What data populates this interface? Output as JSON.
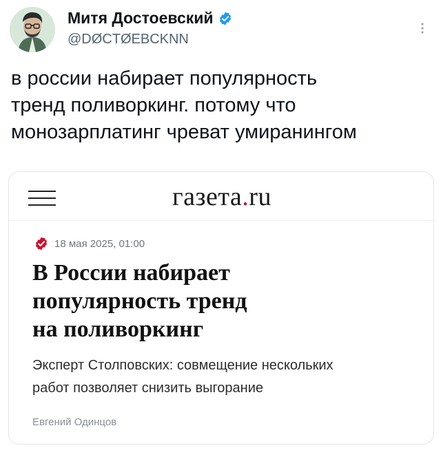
{
  "tweet": {
    "display_name": "Митя Достоевский",
    "handle": "@DØCTØEBCKNN",
    "verified": true,
    "text": "в россии набирает популярность\nтренд поливоркинг. потому что\nмонозарплатинг чреват умиранингом",
    "icons": {
      "avatar": "avatar-portrait",
      "verified": "verified-badge-icon",
      "more": "more-vertical-icon"
    }
  },
  "card": {
    "logo": {
      "main": "газета",
      "dot": ".",
      "tld": "ru"
    },
    "date": "18 мая 2025, 01:00",
    "headline": "В России набирает\nпопулярность тренд\nна поливоркинг",
    "subtitle": "Эксперт Столповских: совмещение нескольких\nработ позволяет снизить выгорание",
    "author": "Евгений Одинцов",
    "icons": {
      "menu": "hamburger-menu-icon",
      "badge": "check-badge-icon"
    }
  },
  "colors": {
    "verified": "#1d9bf0",
    "logo_dot": "#c8102e",
    "badge": "#c8102e"
  }
}
